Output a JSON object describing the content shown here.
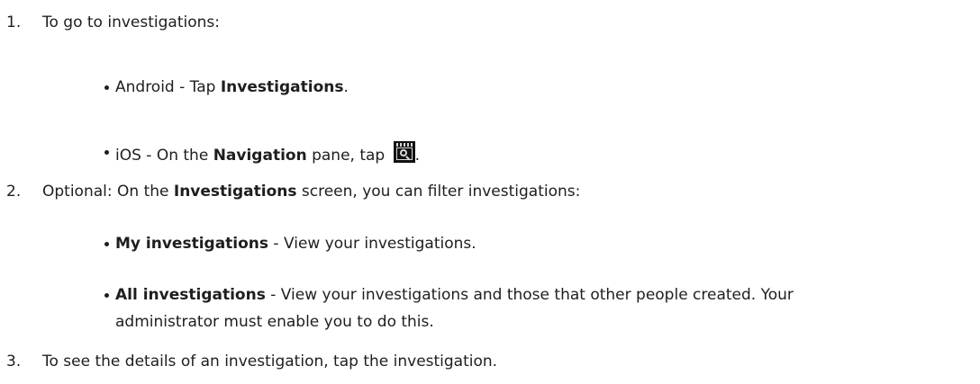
{
  "steps": [
    {
      "number": "1.",
      "text": "To go to investigations:",
      "bullets": [
        {
          "prefix": "Android - Tap ",
          "bold": "Investigations",
          "suffix": "."
        },
        {
          "prefix": "iOS - On the ",
          "bold": "Navigation",
          "middle": " pane, tap ",
          "icon": "investigation-camera-icon",
          "suffix": "."
        }
      ]
    },
    {
      "number": "2.",
      "prefix": "Optional: On the ",
      "bold": "Investigations",
      "suffix": " screen, you can filter investigations:",
      "bullets": [
        {
          "bold": "My investigations",
          "suffix": " - View your investigations."
        },
        {
          "bold": "All investigations",
          "suffix": " - View your investigations and those that other people created. Your",
          "continuation": "administrator must enable you to do this."
        }
      ]
    },
    {
      "number": "3.",
      "text": "To see the details of an investigation, tap the investigation."
    }
  ]
}
